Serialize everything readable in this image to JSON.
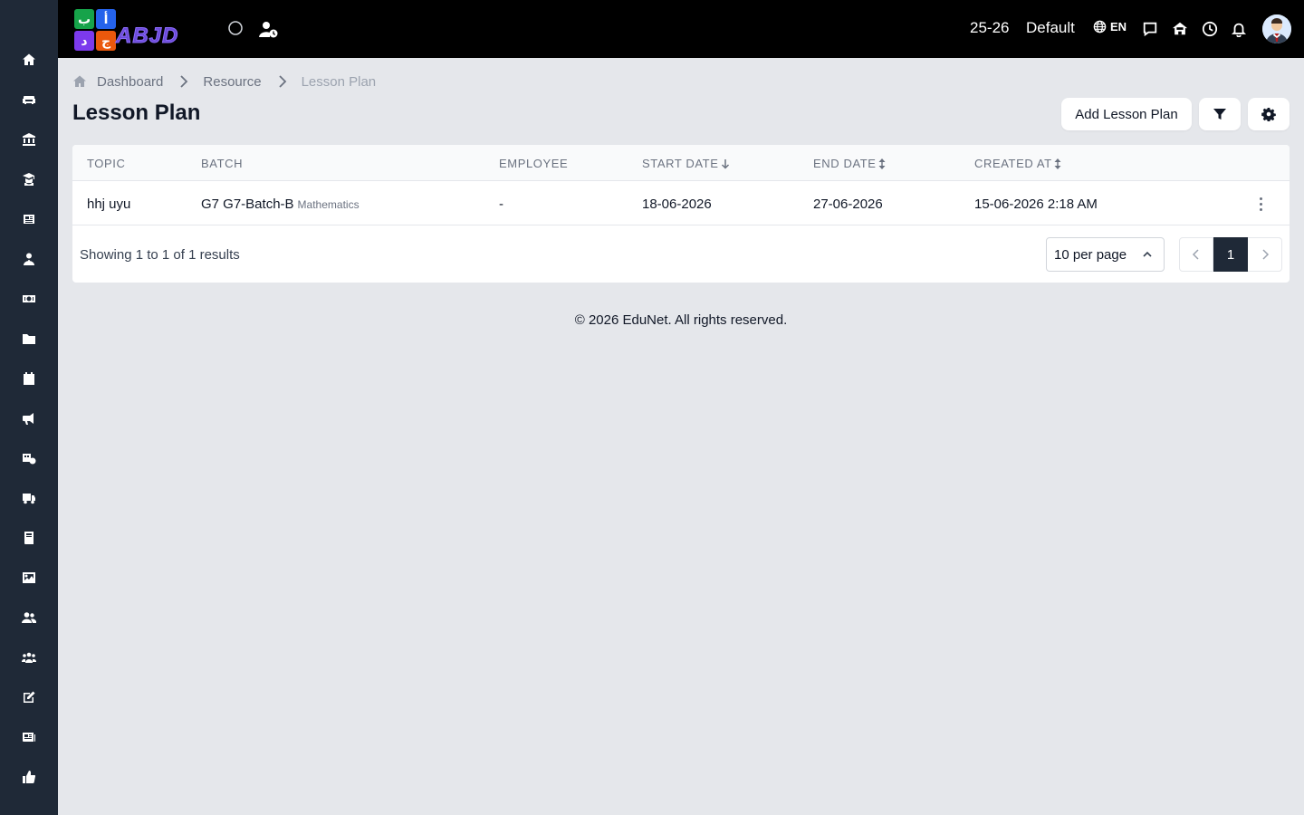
{
  "sidebar": {
    "icons": [
      "home-icon",
      "sofa-icon",
      "institution-icon",
      "graduate-icon",
      "newspaper-icon",
      "person-tie-icon",
      "money-icon",
      "folder-icon",
      "calendar-icon",
      "megaphone-icon",
      "vehicle-gear-icon",
      "truck-icon",
      "book-icon",
      "image-icon",
      "users-icon",
      "group-icon",
      "edit-icon",
      "news-icon",
      "thumbs-up-icon"
    ]
  },
  "topbar": {
    "logo_text": "ABJD",
    "logo_letters": [
      "ب",
      "أ",
      "د",
      "ج"
    ],
    "session": "25-26",
    "school": "Default",
    "language": "EN"
  },
  "breadcrumb": {
    "items": [
      "Dashboard",
      "Resource"
    ],
    "current": "Lesson Plan"
  },
  "page": {
    "title": "Lesson Plan",
    "add_button": "Add Lesson Plan"
  },
  "table": {
    "headers": [
      "TOPIC",
      "BATCH",
      "EMPLOYEE",
      "START DATE",
      "END DATE",
      "CREATED AT"
    ],
    "rows": [
      {
        "topic": "hhj uyu",
        "batch": "G7 G7-Batch-B",
        "subject": "Mathematics",
        "employee": "-",
        "start_date": "18-06-2026",
        "end_date": "27-06-2026",
        "created_at": "15-06-2026 2:18 AM"
      }
    ]
  },
  "pagination": {
    "showing": "Showing 1 to 1 of 1 results",
    "per_page": "10 per page",
    "current_page": "1"
  },
  "footer": {
    "text": "© 2026 EduNet. All rights reserved."
  },
  "colors": {
    "sidebar_bg": "#1f2937",
    "topbar_bg": "#000000",
    "page_bg": "#e5e7eb",
    "accent": "#1f2937"
  }
}
